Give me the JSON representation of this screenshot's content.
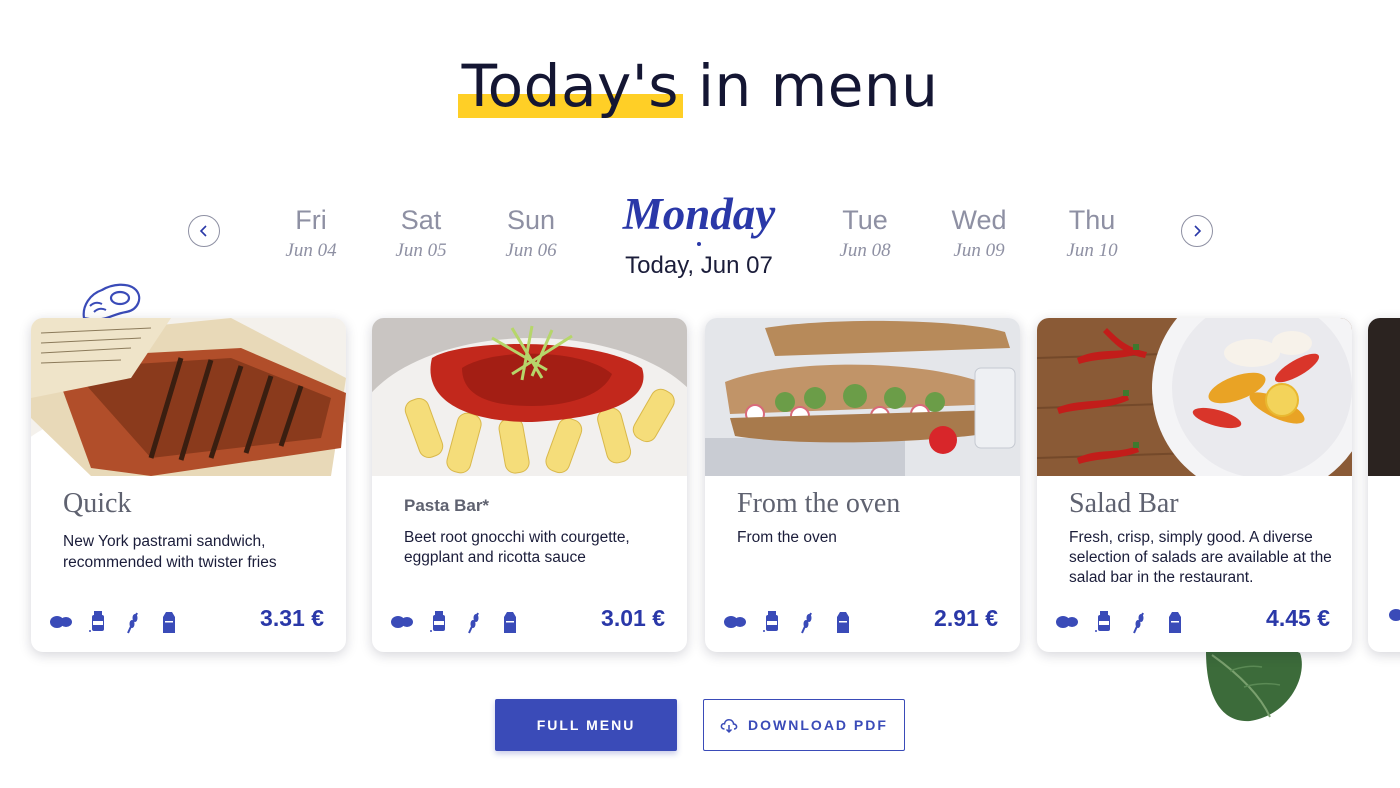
{
  "title": {
    "highlighted": "Today's",
    "rest": " in menu"
  },
  "days": [
    {
      "name": "Fri",
      "date": "Jun 04"
    },
    {
      "name": "Sat",
      "date": "Jun 05"
    },
    {
      "name": "Sun",
      "date": "Jun 06"
    },
    {
      "name": "Monday",
      "date": "Today, Jun 07",
      "active": true
    },
    {
      "name": "Tue",
      "date": "Jun 08"
    },
    {
      "name": "Wed",
      "date": "Jun 09"
    },
    {
      "name": "Thu",
      "date": "Jun 10"
    }
  ],
  "cards": [
    {
      "name": "Quick",
      "description": "New York pastrami sandwich, recommended with twister fries",
      "price": "3.31 €",
      "image": "wrap sandwich"
    },
    {
      "name": "Pasta Bar*",
      "description": "Beet root gnocchi with courgette, eggplant and ricotta sauce",
      "price": "3.01 €",
      "image": "pasta"
    },
    {
      "name": "From the oven",
      "description": "From the oven",
      "price": "2.91 €",
      "image": "baguette sandwich"
    },
    {
      "name": "Salad Bar",
      "description": "Fresh, crisp, simply good. A diverse selection of salads are available at the salad bar in the restaurant.",
      "price": "4.45 €",
      "image": "salad"
    }
  ],
  "allergen_icons": [
    "bread-icon",
    "mustard-icon",
    "wheat-icon",
    "milk-carton-icon"
  ],
  "buttons": {
    "full_menu": "FULL MENU",
    "download_pdf": "DOWNLOAD PDF"
  },
  "colors": {
    "accent": "#2a38a8",
    "button": "#3a4bb8",
    "highlight": "#ffcf26",
    "muted": "#8e90a3"
  }
}
